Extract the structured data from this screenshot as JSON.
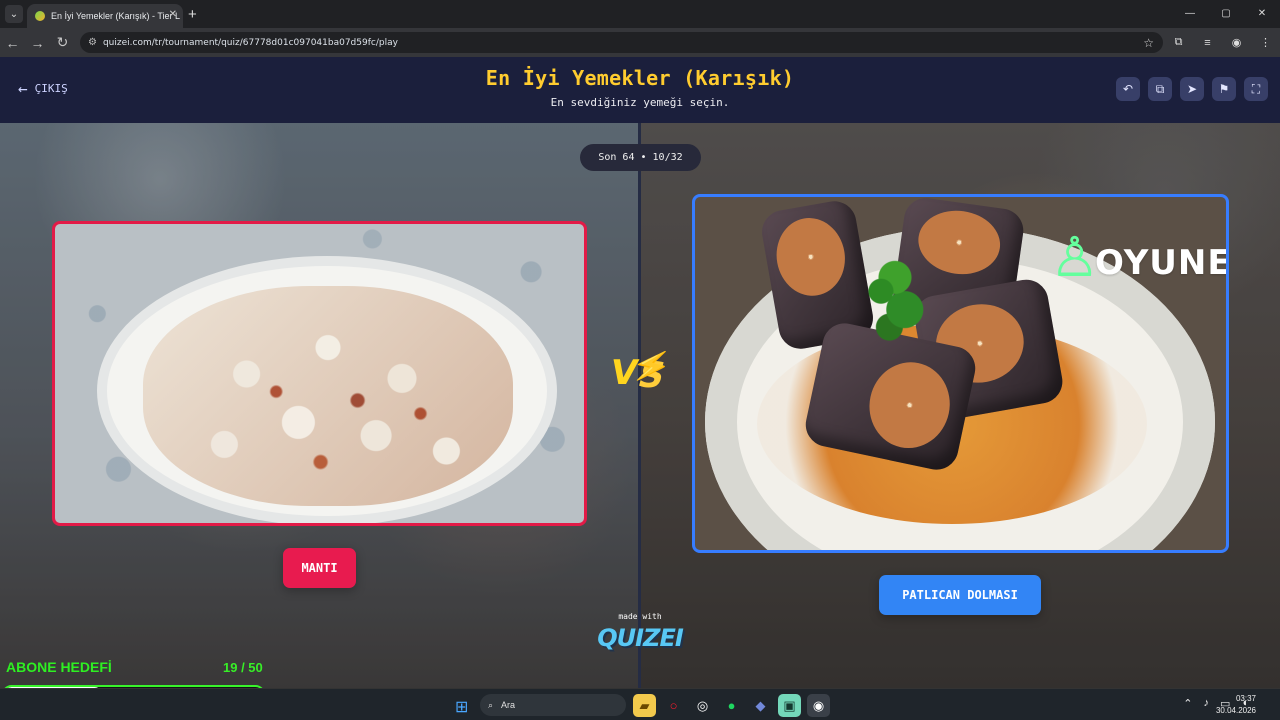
{
  "browser": {
    "tab_title": "En İyi Yemekler (Karışık) - Tier L",
    "address_url": "quizei.com/tr/tournament/quiz/67778d01c097041ba07d59fc/play",
    "window_controls": [
      "—",
      "▢",
      "✕"
    ]
  },
  "header": {
    "exit_label": "ÇIKIŞ",
    "title": "En İyi Yemekler (Karışık)",
    "subtitle": "En sevdiğiniz yemeği seçin.",
    "action_icons": [
      "undo-icon",
      "copy-icon",
      "send-icon",
      "flag-icon",
      "fullscreen-icon"
    ]
  },
  "round": {
    "label": "Son 64 • 10/32"
  },
  "choices": {
    "left": {
      "name": "MANTI",
      "accent": "#e21a47"
    },
    "right": {
      "name": "PATLICAN DOLMASI",
      "accent": "#377dff",
      "watermark": "OYUNEKS"
    }
  },
  "branding": {
    "made_with": "made with",
    "logo": "QUIZEI"
  },
  "overlay": {
    "goal_label": "ABONE HEDEFİ",
    "goal_count": "19 / 50",
    "goal_progress": 0.38
  },
  "taskbar": {
    "search_placeholder": "Ara",
    "time": "03:37",
    "date": "30.04.2026"
  }
}
